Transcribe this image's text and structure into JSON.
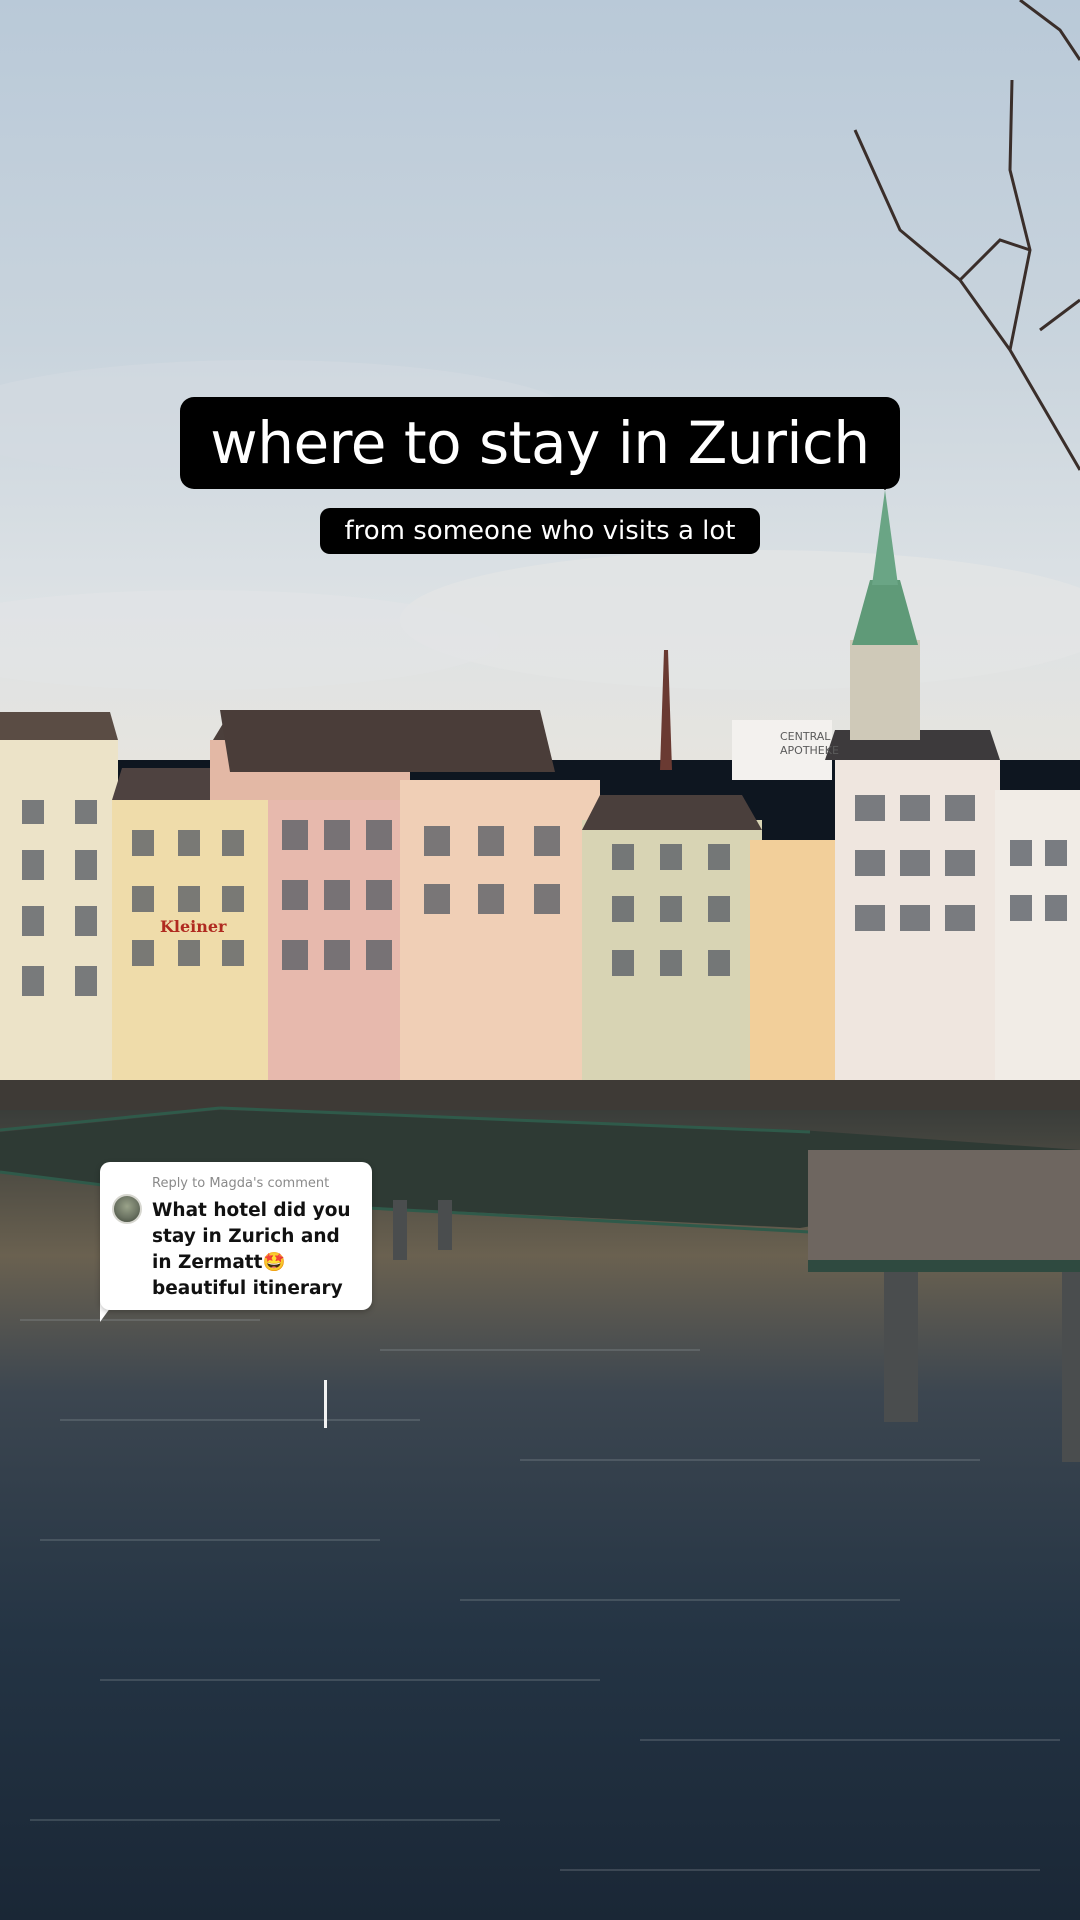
{
  "overlay": {
    "title": "where to stay in Zurich",
    "subtitle": "from someone who visits a lot"
  },
  "reply_card": {
    "header": "Reply to Magda's comment",
    "comment_part1": "What hotel did you stay in Zurich and in Zermatt",
    "emoji": "🤩",
    "comment_part2": "beautiful itinerary"
  },
  "scene": {
    "shop_sign_kleiner": "Kleiner",
    "shop_sign_apotheke_line1": "CENTRAL",
    "shop_sign_apotheke_line2": "APOTHEKE"
  },
  "colors": {
    "caption_bg": "#000000",
    "caption_text": "#ffffff",
    "card_bg": "#ffffff",
    "spire_green": "#5f9a78",
    "water_dark": "#1c2a38"
  }
}
